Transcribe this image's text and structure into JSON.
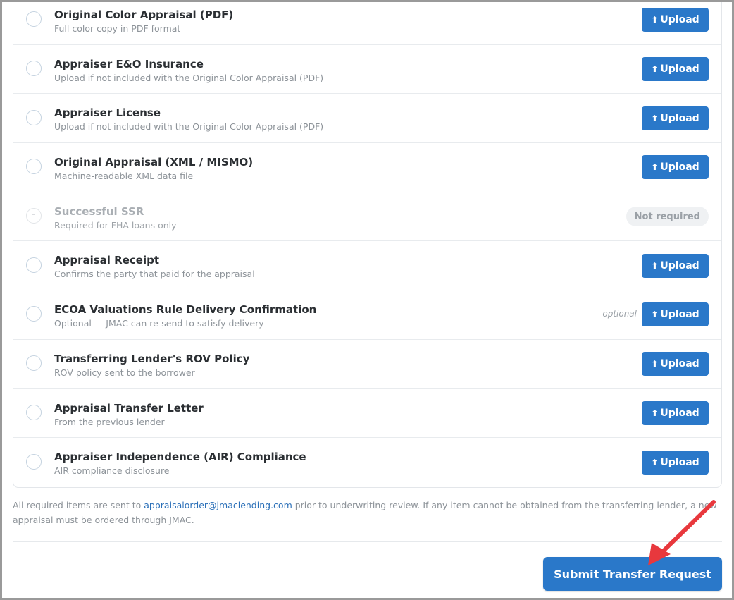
{
  "documents": [
    {
      "title": "Original Color Appraisal (PDF)",
      "subtitle": "Full color copy in PDF format",
      "action": "↑ Upload"
    },
    {
      "title": "Appraiser E&O Insurance",
      "subtitle": "Upload if not included with the Original Color Appraisal (PDF)",
      "action": "↑ Upload"
    },
    {
      "title": "Appraiser License",
      "subtitle": "Upload if not included with the Original Color Appraisal (PDF)",
      "action": "↑ Upload"
    },
    {
      "title": "Original Appraisal (XML / MISMO)",
      "subtitle": "Machine-readable XML data file",
      "action": "↑ Upload"
    },
    {
      "title": "Successful SSR",
      "subtitle": "Required for FHA loans only",
      "status": "Not required",
      "disabled_mark": "–"
    },
    {
      "title": "Appraisal Receipt",
      "subtitle": "Confirms the party that paid for the appraisal",
      "action": "↑ Upload"
    },
    {
      "title": "ECOA Valuations Rule Delivery Confirmation",
      "subtitle": "Optional — JMAC can re-send to satisfy delivery",
      "tag": "optional",
      "action": "↑ Upload"
    },
    {
      "title": "Transferring Lender's ROV Policy",
      "subtitle": "ROV policy sent to the borrower",
      "action": "↑ Upload"
    },
    {
      "title": "Appraisal Transfer Letter",
      "subtitle": "From the previous lender",
      "action": "↑ Upload"
    },
    {
      "title": "Appraiser Independence (AIR) Compliance",
      "subtitle": "AIR compliance disclosure",
      "action": "↑ Upload"
    }
  ],
  "upload_label": "Upload",
  "upload_arrow": "⬆",
  "footnote": {
    "before": "All required items are sent to ",
    "email": "appraisalorder@jmaclending.com",
    "after": " prior to underwriting review. If any item cannot be obtained from the transferring lender, a new appraisal must be ordered through JMAC."
  },
  "submit_label": "Submit Transfer Request",
  "colors": {
    "primary": "#2a78c9",
    "annotation_arrow": "#e8383d"
  }
}
